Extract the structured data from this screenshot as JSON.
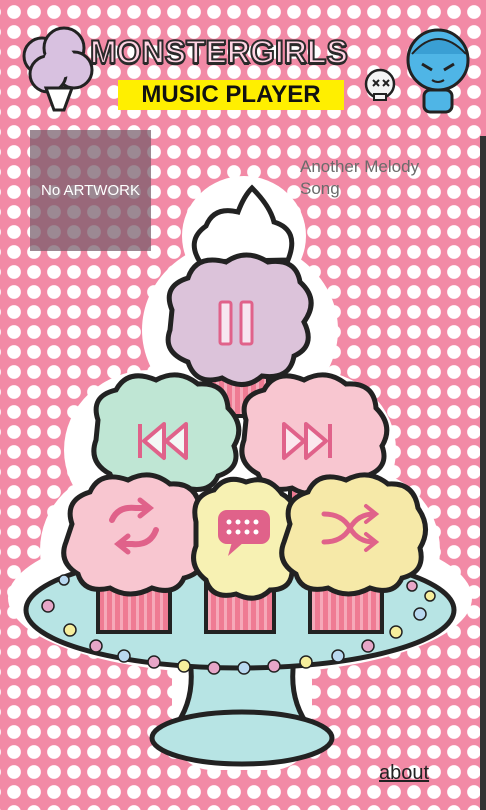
{
  "header": {
    "logo_text": "MONSTERGIRLS",
    "subtitle": "MUSIC PLAYER"
  },
  "artwork": {
    "placeholder": "No ARTWORK"
  },
  "track": {
    "title_line1": "Another Melody",
    "title_line2": "Song"
  },
  "controls": {
    "play_pause": "pause-icon",
    "previous": "skip-previous-icon",
    "next": "skip-next-icon",
    "repeat": "repeat-icon",
    "lyrics": "chat-bubble-icon",
    "shuffle": "shuffle-icon"
  },
  "footer": {
    "about_label": "about"
  },
  "colors": {
    "background_pink": "#f28aa6",
    "cupcake_purple": "#dcc3da",
    "cupcake_mint": "#bfe6d4",
    "cupcake_pink": "#f8c6d0",
    "cupcake_yellow": "#f7f1b3",
    "cupcake_cream": "#f6e9a8",
    "liner_pink": "#ef7b93",
    "stand_blue": "#b7e4e4",
    "subtitle_yellow": "#ffef00"
  }
}
